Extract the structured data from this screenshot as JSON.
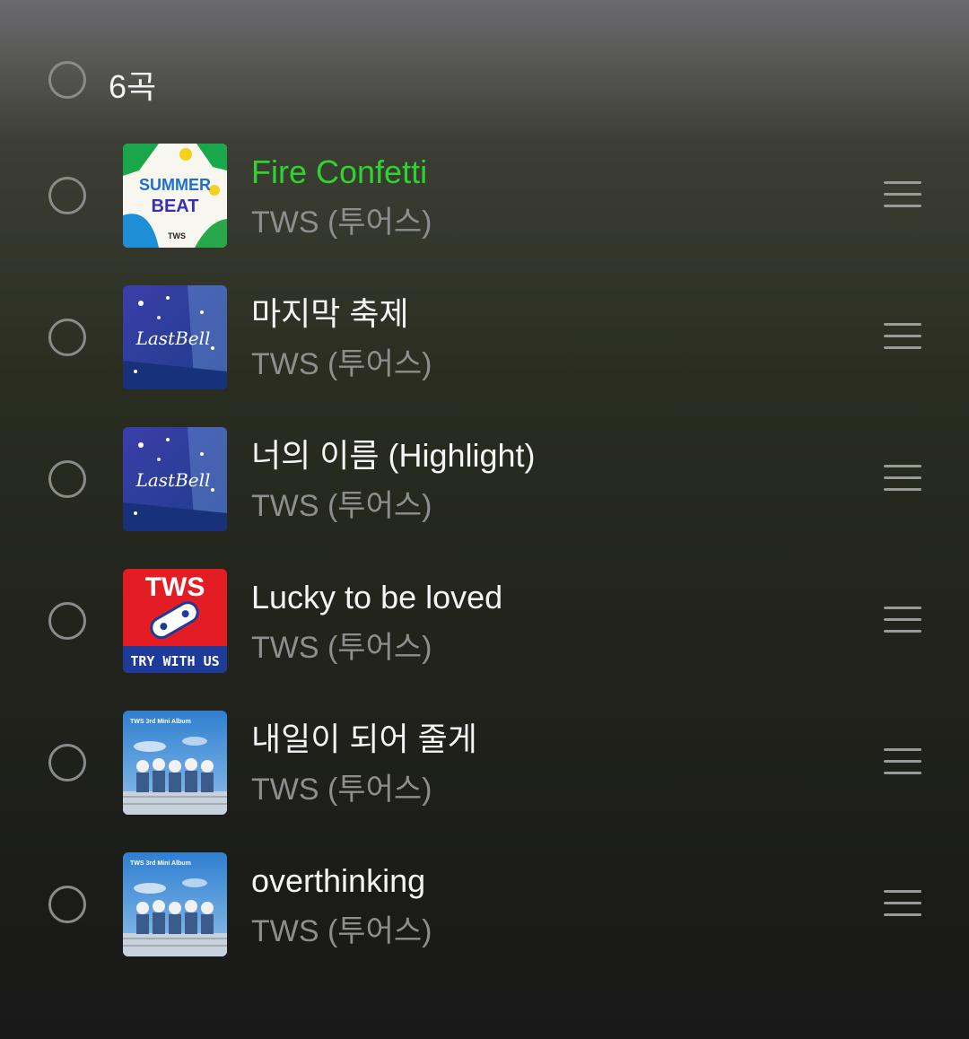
{
  "header": {
    "count_label": "6곡"
  },
  "tracks": [
    {
      "title": "Fire Confetti",
      "artist": "TWS (투어스)",
      "playing": true,
      "art": "summer-beat-cover"
    },
    {
      "title": "마지막 축제",
      "artist": "TWS (투어스)",
      "playing": false,
      "art": "last-bell-cover"
    },
    {
      "title": "너의 이름 (Highlight)",
      "artist": "TWS (투어스)",
      "playing": false,
      "art": "last-bell-cover"
    },
    {
      "title": "Lucky to be loved",
      "artist": "TWS (투어스)",
      "playing": false,
      "art": "try-with-us-cover"
    },
    {
      "title": "내일이 되어 줄게",
      "artist": "TWS (투어스)",
      "playing": false,
      "art": "mini-album-cover"
    },
    {
      "title": "overthinking",
      "artist": "TWS (투어스)",
      "playing": false,
      "art": "mini-album-cover"
    }
  ],
  "art_text": {
    "summer_beat": [
      "SUMMER",
      "BEAT",
      "TWS"
    ],
    "last_bell": "LastBell",
    "try_with_us": [
      "TWS",
      "TRY WITH US"
    ],
    "mini_album": "TWS 3rd Mini Album"
  },
  "colors": {
    "playing_title": "#2fd32f",
    "title": "#f4f4f4",
    "artist": "#8e8e8e"
  }
}
